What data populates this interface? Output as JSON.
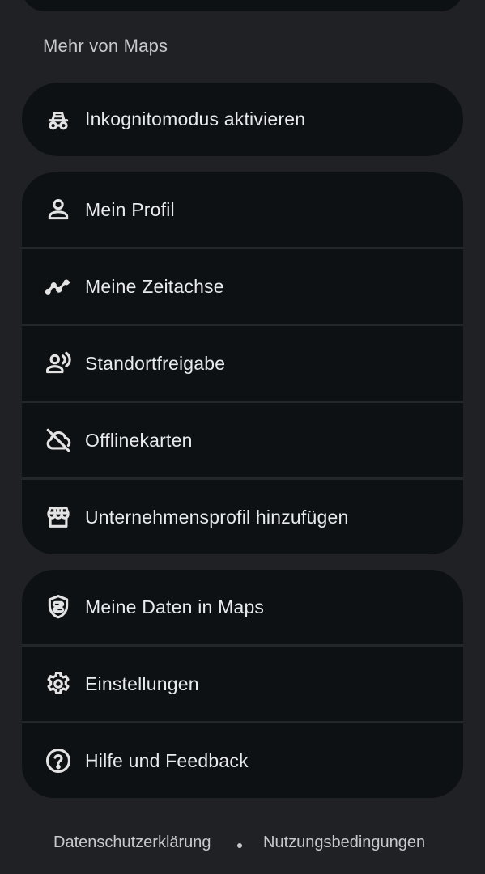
{
  "section_title": "Mehr von Maps",
  "group1": [
    {
      "label": "Inkognitomodus aktivieren",
      "icon": "incognito-icon"
    }
  ],
  "group2": [
    {
      "label": "Mein Profil",
      "icon": "person-icon"
    },
    {
      "label": "Meine Zeitachse",
      "icon": "timeline-icon"
    },
    {
      "label": "Standortfreigabe",
      "icon": "location-sharing-icon"
    },
    {
      "label": "Offlinekarten",
      "icon": "cloud-off-icon"
    },
    {
      "label": "Unternehmensprofil hinzufügen",
      "icon": "storefront-icon"
    }
  ],
  "group3": [
    {
      "label": "Meine Daten in Maps",
      "icon": "shield-data-icon"
    },
    {
      "label": "Einstellungen",
      "icon": "gear-icon"
    },
    {
      "label": "Hilfe und Feedback",
      "icon": "help-icon"
    }
  ],
  "footer": {
    "privacy": "Datenschutzerklärung",
    "terms": "Nutzungsbedingungen"
  },
  "colors": {
    "background": "#1f2124",
    "card": "#0e1113",
    "text": "#e8eaed",
    "secondary_text": "#c7c9cc"
  }
}
